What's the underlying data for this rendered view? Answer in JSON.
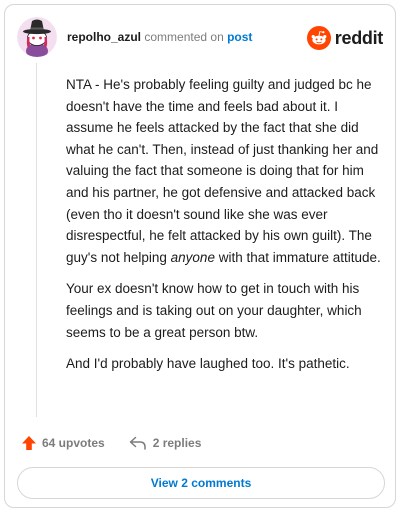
{
  "header": {
    "username": "repolho_azul",
    "action_text": "commented on",
    "post_link": "post",
    "logo_text": "reddit"
  },
  "comment": {
    "p1_part1": "NTA - He's probably feeling guilty and judged bc he doesn't have the time and feels bad about it. I assume he feels attacked by the fact that she did what he can't. Then, instead of just thanking her and valuing the fact that someone is doing that for him and his partner, he got defensive and attacked back (even tho it doesn't sound like she was ever disrespectful, he felt attacked by his own guilt). The guy's not helping ",
    "p1_emphasis": "anyone",
    "p1_part2": " with that immature attitude.",
    "p2": "Your ex doesn't know how to get in touch with his feelings and is taking out on your daughter, which seems to be a great person btw.",
    "p3": "And I'd probably have laughed too. It's pathetic."
  },
  "footer": {
    "upvotes": "64 upvotes",
    "replies": "2 replies"
  },
  "view_button": "View 2 comments",
  "colors": {
    "upvote_orange": "#ff4500",
    "link_blue": "#0079d3",
    "muted_gray": "#7c7c7c"
  },
  "icons": {
    "avatar": "snoo-avatar-witch-hat",
    "logo": "reddit-snoo-icon",
    "upvote": "upvote-arrow-icon",
    "reply": "reply-arrow-icon"
  }
}
